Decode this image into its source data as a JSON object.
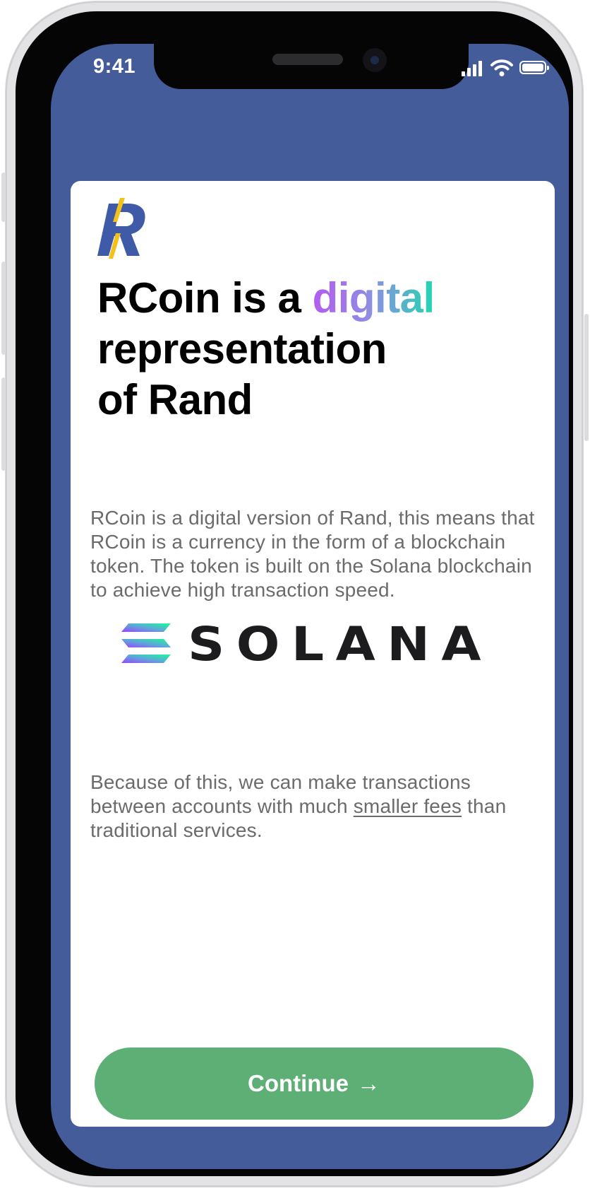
{
  "status_bar": {
    "time": "9:41"
  },
  "header": {
    "title_prefix": "RCoin is a ",
    "title_accent": "digital",
    "title_line2": "representation",
    "title_line3": "of Rand"
  },
  "content": {
    "intro": "RCoin is a digital version of Rand, this means that RCoin is a currency in the form of a blockchain token. The token is built on the Solana blockchain to achieve high transaction speed.",
    "partner_logo_text": "SOLANA",
    "fees_before": "Because of this, we can make transactions between accounts with much ",
    "fees_link": "smaller fees",
    "fees_after": " than traditional services."
  },
  "actions": {
    "continue_label": "Continue",
    "continue_icon": "→"
  },
  "colors": {
    "screen_background": "#455c9b",
    "card_background": "#ffffff",
    "button": "#5daf76",
    "logo_blue": "#3f5aa6",
    "logo_yellow": "#f3c11b",
    "accent_gradient": [
      "#b45bf0",
      "#8b91e2",
      "#21d6b0"
    ]
  }
}
